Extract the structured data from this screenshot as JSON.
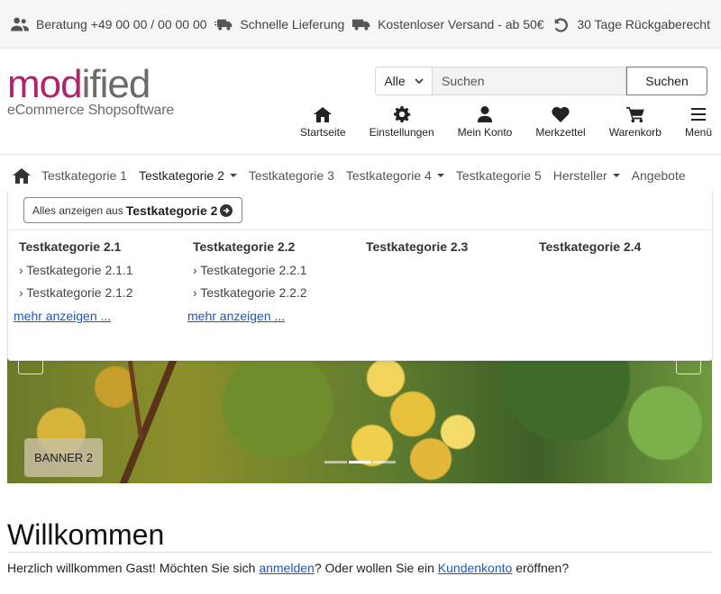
{
  "topbar": {
    "items": [
      {
        "icon": "users-icon",
        "label": "Beratung +49 00 00 / 00 00 00"
      },
      {
        "icon": "truck-fast-icon",
        "label": "Schnelle Lieferung"
      },
      {
        "icon": "truck-icon",
        "label": "Kostenloser Versand - ab 50€"
      },
      {
        "icon": "undo-icon",
        "label": "30 Tage Rückgaberecht"
      }
    ]
  },
  "header": {
    "logo": {
      "part1": "mod",
      "part2": "ified",
      "tagline": "eCommerce Shopsoftware"
    },
    "search": {
      "category": "Alle",
      "placeholder": "Suchen",
      "button": "Suchen"
    },
    "nav": [
      {
        "icon": "home-icon",
        "label": "Startseite"
      },
      {
        "icon": "gear-icon",
        "label": "Einstellungen"
      },
      {
        "icon": "user-icon",
        "label": "Mein Konto"
      },
      {
        "icon": "heart-icon",
        "label": "Merkzettel"
      },
      {
        "icon": "cart-icon",
        "label": "Warenkorb"
      },
      {
        "icon": "menu-icon",
        "label": "Menü"
      }
    ]
  },
  "catnav": {
    "items": [
      {
        "label": "Testkategorie 1",
        "dropdown": false
      },
      {
        "label": "Testkategorie 2",
        "dropdown": true
      },
      {
        "label": "Testkategorie 3",
        "dropdown": false
      },
      {
        "label": "Testkategorie 4",
        "dropdown": true
      },
      {
        "label": "Testkategorie 5",
        "dropdown": false
      },
      {
        "label": "Hersteller",
        "dropdown": true
      },
      {
        "label": "Angebote",
        "dropdown": false
      }
    ]
  },
  "dropdown": {
    "all_prefix": "Alles anzeigen aus",
    "all_category": "Testkategorie 2",
    "columns": [
      {
        "heading": "Testkategorie 2.1",
        "subs": [
          "› Testkategorie 2.1.1",
          "› Testkategorie 2.1.2"
        ],
        "more": "mehr anzeigen ..."
      },
      {
        "heading": "Testkategorie 2.2",
        "subs": [
          "› Testkategorie 2.2.1",
          "› Testkategorie 2.2.2"
        ],
        "more": "mehr anzeigen ..."
      },
      {
        "heading": "Testkategorie 2.3",
        "subs": [],
        "more": ""
      },
      {
        "heading": "Testkategorie 2.4",
        "subs": [],
        "more": ""
      }
    ]
  },
  "banner": {
    "label": "BANNER 2",
    "active_slide": 2,
    "slide_count": 3
  },
  "welcome": {
    "title": "Willkommen",
    "text_before": "Herzlich willkommen Gast! Möchten Sie sich ",
    "link1": "anmelden",
    "text_middle": "? Oder wollen Sie ein ",
    "link2": "Kundenkonto",
    "text_after": " eröffnen?"
  },
  "colors": {
    "brand": "#b2226e",
    "logo_gray": "#6b6b6b",
    "link": "#1a56c4"
  }
}
